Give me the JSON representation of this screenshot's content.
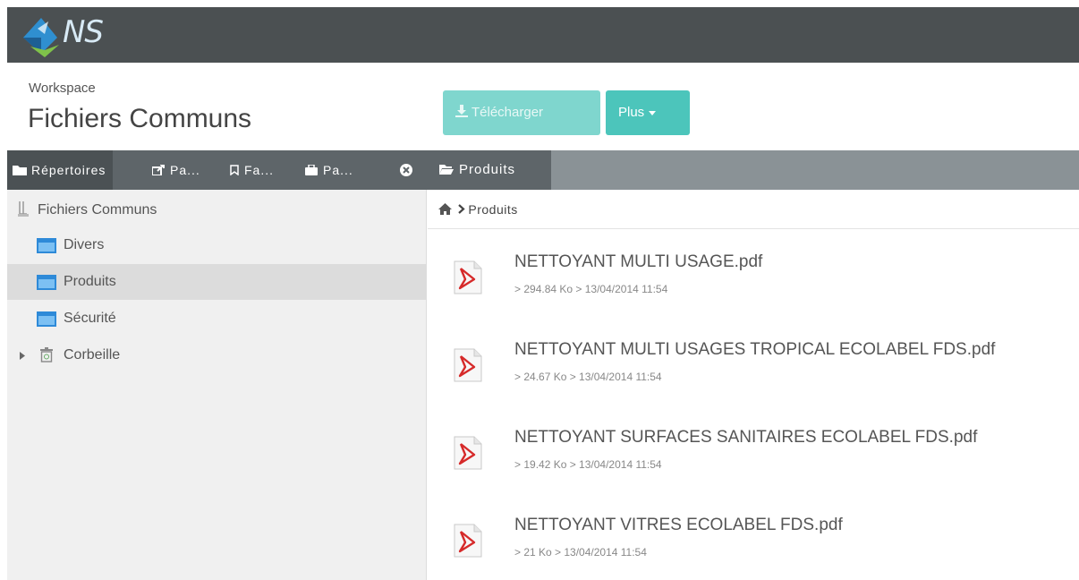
{
  "app": {
    "logo_text": "NS"
  },
  "header": {
    "workspace_label": "Workspace",
    "workspace_title": "Fichiers Communs",
    "download_label": "Télécharger",
    "more_label": "Plus"
  },
  "left_tabs": [
    {
      "label": "Répertoires",
      "icon": "folder-icon"
    },
    {
      "label": "Pa...",
      "icon": "share-icon"
    },
    {
      "label": "Fa...",
      "icon": "bookmark-icon"
    },
    {
      "label": "Pa...",
      "icon": "briefcase-icon"
    }
  ],
  "right_tab": {
    "label": "Produits",
    "icon": "folder-open-icon"
  },
  "tree": {
    "root": "Fichiers Communs",
    "items": [
      {
        "label": "Divers"
      },
      {
        "label": "Produits"
      },
      {
        "label": "Sécurité"
      },
      {
        "label": "Corbeille"
      }
    ]
  },
  "breadcrumb": {
    "current": "Produits"
  },
  "files": [
    {
      "name": "NETTOYANT MULTI USAGE.pdf",
      "meta": "> 294.84 Ko > 13/04/2014 11:54"
    },
    {
      "name": "NETTOYANT MULTI USAGES TROPICAL ECOLABEL FDS.pdf",
      "meta": "> 24.67 Ko > 13/04/2014 11:54"
    },
    {
      "name": "NETTOYANT SURFACES SANITAIRES ECOLABEL FDS.pdf",
      "meta": "> 19.42 Ko > 13/04/2014 11:54"
    },
    {
      "name": "NETTOYANT VITRES ECOLABEL FDS.pdf",
      "meta": "> 21 Ko > 13/04/2014 11:54"
    }
  ],
  "colors": {
    "topbar": "#4b5052",
    "accent": "#4cc5bb",
    "tabs": "#5e6569",
    "pdf_red": "#d62a2a"
  }
}
